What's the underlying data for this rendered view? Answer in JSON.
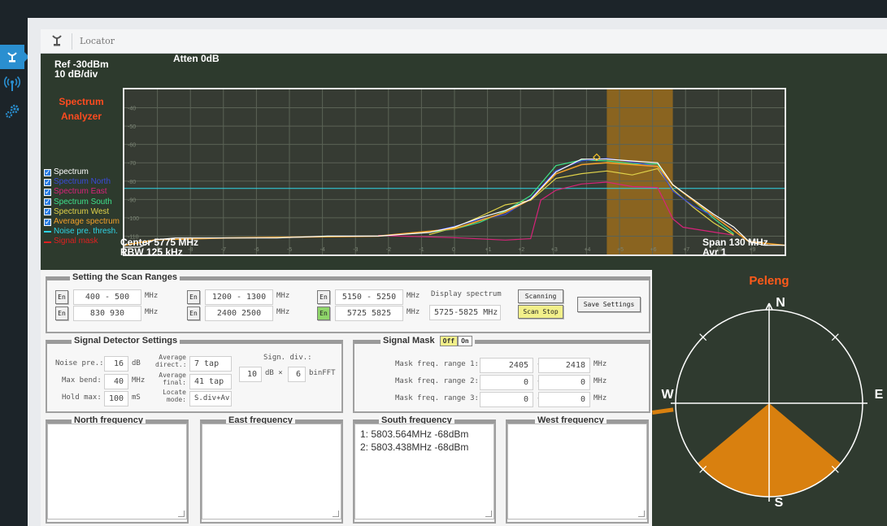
{
  "window": {
    "title": "Locator"
  },
  "sidebar": {
    "items": [
      {
        "icon": "locator-icon",
        "active": true
      },
      {
        "icon": "radar-icon"
      },
      {
        "icon": "settings-gears-icon"
      }
    ]
  },
  "analyzer": {
    "ref": "Ref -30dBm",
    "div": "10 dB/div",
    "atten": "Atten 0dB",
    "name_line1": "Spectrum",
    "name_line2": "Analyzer",
    "center": "Center 5775 MHz",
    "rbw": "RBW 125 kHz",
    "span": "Span 130 MHz",
    "avr": "Avr 1",
    "legend": [
      {
        "label": "Spectrum",
        "color": "#ffffff",
        "type": "checkbox"
      },
      {
        "label": "Spectrum North",
        "color": "#3a4bd8",
        "type": "checkbox"
      },
      {
        "label": "Spectrum East",
        "color": "#d8237a",
        "type": "checkbox"
      },
      {
        "label": "Spectrum South",
        "color": "#3ee08a",
        "type": "checkbox"
      },
      {
        "label": "Spectrum West",
        "color": "#e0d24a",
        "type": "checkbox"
      },
      {
        "label": "Average spectrum",
        "color": "#f2a02a",
        "type": "checkbox"
      },
      {
        "label": "Noise pre. thresh.",
        "color": "#2fd6e8",
        "type": "line"
      },
      {
        "label": "Signal mask",
        "color": "#e02020",
        "type": "line"
      }
    ],
    "y_ticks": [
      "-40",
      "-50",
      "-60",
      "-70",
      "-80",
      "-90",
      "-100",
      "-110"
    ],
    "x_ticks": [
      "-9",
      "-8",
      "-7",
      "-6",
      "-5",
      "-4",
      "-3",
      "-2",
      "-1",
      "0",
      "+1",
      "+2",
      "+3",
      "+4",
      "+5",
      "+6",
      "+7",
      "+8",
      "+9"
    ]
  },
  "chart_data": {
    "type": "line",
    "ylim": [
      -120,
      -30
    ],
    "xlim": [
      5710,
      5840
    ],
    "noise_threshold": -84,
    "mask_range_mhz": [
      5805,
      5818
    ],
    "series": [
      {
        "name": "Spectrum",
        "color": "#ffffff",
        "x": [
          5710,
          5713,
          5716,
          5720,
          5730,
          5740,
          5750,
          5760,
          5765,
          5770,
          5775,
          5780,
          5785,
          5790,
          5795,
          5800,
          5805,
          5810,
          5815,
          5818,
          5822,
          5826,
          5830,
          5833,
          5836,
          5840
        ],
        "y": [
          -116,
          -116,
          -112,
          -111,
          -111,
          -111,
          -110,
          -110,
          -109,
          -108,
          -105,
          -100,
          -96,
          -90,
          -75,
          -68,
          -68,
          -69,
          -70,
          -82,
          -90,
          -98,
          -105,
          -113,
          -115,
          -115
        ]
      },
      {
        "name": "Spectrum North",
        "color": "#3a4bd8",
        "x": [
          5770,
          5775,
          5780,
          5785,
          5790,
          5795,
          5800,
          5805,
          5810,
          5815,
          5818,
          5822,
          5826,
          5830
        ],
        "y": [
          -109,
          -106,
          -101,
          -97,
          -88,
          -74,
          -70,
          -69,
          -70,
          -71,
          -84,
          -93,
          -100,
          -108
        ]
      },
      {
        "name": "Spectrum East",
        "color": "#d8237a",
        "x": [
          5760,
          5775,
          5785,
          5790,
          5792,
          5795,
          5800,
          5805,
          5810,
          5815,
          5818,
          5820,
          5830
        ],
        "y": [
          -111,
          -111,
          -111,
          -110,
          -90,
          -86,
          -83,
          -81,
          -82,
          -82,
          -100,
          -106,
          -111
        ]
      },
      {
        "name": "Spectrum South",
        "color": "#3ee08a",
        "x": [
          5770,
          5775,
          5780,
          5785,
          5790,
          5795,
          5800,
          5805,
          5810,
          5815,
          5818,
          5822,
          5826,
          5830
        ],
        "y": [
          -108,
          -105,
          -101,
          -96,
          -89,
          -73,
          -69,
          -68,
          -69,
          -70,
          -83,
          -92,
          -101,
          -108
        ]
      },
      {
        "name": "Spectrum West",
        "color": "#e0d24a",
        "x": [
          5770,
          5775,
          5780,
          5785,
          5790,
          5795,
          5800,
          5805,
          5810,
          5815,
          5818,
          5822,
          5826,
          5830
        ],
        "y": [
          -108,
          -104,
          -99,
          -94,
          -92,
          -79,
          -75,
          -73,
          -76,
          -74,
          -86,
          -95,
          -102,
          -108
        ]
      },
      {
        "name": "Average spectrum",
        "color": "#f2a02a",
        "x": [
          5710,
          5716,
          5730,
          5760,
          5775,
          5785,
          5790,
          5795,
          5800,
          5805,
          5810,
          5815,
          5818,
          5826,
          5833,
          5840
        ],
        "y": [
          -115,
          -112,
          -111,
          -110,
          -106,
          -97,
          -90,
          -76,
          -71,
          -70,
          -71,
          -72,
          -82,
          -99,
          -113,
          -115
        ]
      }
    ]
  },
  "scan": {
    "title": "Setting the Scan Ranges",
    "en_label": "En",
    "unit": "MHz",
    "rows": [
      {
        "en": "En",
        "range": "400 - 500",
        "unit": "MHz",
        "on": false
      },
      {
        "en": "En",
        "range": "830   930",
        "unit": "MHz",
        "on": false
      },
      {
        "en": "En",
        "range": "1200 - 1300",
        "unit": "MHz",
        "on": false
      },
      {
        "en": "En",
        "range": "2400   2500",
        "unit": "MHz",
        "on": false
      },
      {
        "en": "En",
        "range": "5150 - 5250",
        "unit": "MHz",
        "on": false
      },
      {
        "en": "En",
        "range": "5725   5825",
        "unit": "MHz",
        "on": true
      }
    ],
    "display_label": "Display spectrum",
    "display_value": "5725-5825 MHz",
    "scanning_btn": "Scanning",
    "scan_stop_btn": "Scan Stop",
    "save_btn": "Save Settings"
  },
  "detector": {
    "title": "Signal Detector Settings",
    "noise_label": "Noise pre.:",
    "noise_value": "16",
    "noise_unit": "dB",
    "maxbend_label": "Max bend:",
    "maxbend_value": "40",
    "maxbend_unit": "MHz",
    "hold_label": "Hold max:",
    "hold_value": "100",
    "hold_unit": "mS",
    "avg_direct_label1": "Average",
    "avg_direct_label2": "direct.:",
    "avg_direct_value": "7 tap",
    "avg_final_label1": "Average",
    "avg_final_label2": "final:",
    "avg_final_value": "41 tap",
    "locate_label1": "Locate",
    "locate_label2": "mode:",
    "locate_value": "S.div+Avr",
    "sign_div_label": "Sign. div.:",
    "sign_div_value1": "10",
    "sign_div_mid": "dB ×",
    "sign_div_value2": "6",
    "sign_div_unit": "binFFT"
  },
  "mask": {
    "title": "Signal Mask",
    "off": "Off",
    "on": "On",
    "rows": [
      {
        "label": "Mask freq. range 1:",
        "from": "2405",
        "to": "2418",
        "unit": "MHz"
      },
      {
        "label": "Mask freq. range 2:",
        "from": "0",
        "to": "0",
        "unit": "MHz"
      },
      {
        "label": "Mask freq. range 3:",
        "from": "0",
        "to": "0",
        "unit": "MHz"
      }
    ]
  },
  "frequencies": {
    "north_title": "North frequency",
    "east_title": "East frequency",
    "south_title": "South frequency",
    "west_title": "West frequency",
    "south_line1": "1: 5803.564MHz  -68dBm",
    "south_line2": "2: 5803.438MHz  -68dBm"
  },
  "peleng": {
    "title": "Peleng",
    "n": "N",
    "s": "S",
    "e": "E",
    "w": "W",
    "sector_color": "#d9800f",
    "title_color": "#ff5a1a",
    "sector_start_deg": 130,
    "sector_end_deg": 230
  }
}
